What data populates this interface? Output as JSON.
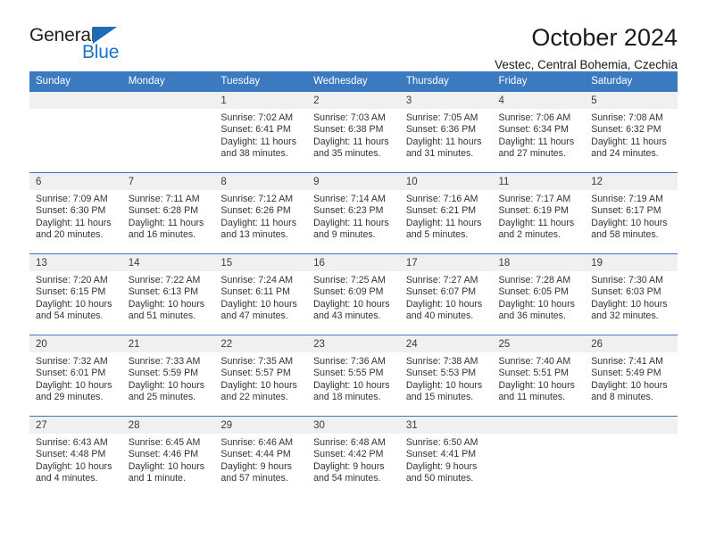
{
  "brand": {
    "name_top": "General",
    "name_bottom": "Blue",
    "triangle_icon": "brand-triangle-icon",
    "color_dark": "#231f20",
    "color_blue": "#1b74c7"
  },
  "header": {
    "title": "October 2024",
    "subtitle": "Vestec, Central Bohemia, Czechia"
  },
  "theme": {
    "header_blue": "#3b79c0",
    "daynum_band": "#f0f0f0",
    "text": "#333333"
  },
  "calendar": {
    "weekday_headers": [
      "Sunday",
      "Monday",
      "Tuesday",
      "Wednesday",
      "Thursday",
      "Friday",
      "Saturday"
    ],
    "labels": {
      "sunrise": "Sunrise:",
      "sunset": "Sunset:",
      "daylight": "Daylight:"
    },
    "weeks": [
      [
        {
          "day": "",
          "empty": true
        },
        {
          "day": "",
          "empty": true
        },
        {
          "day": "1",
          "sunrise": "Sunrise: 7:02 AM",
          "sunset": "Sunset: 6:41 PM",
          "daylight_1": "Daylight: 11 hours",
          "daylight_2": "and 38 minutes."
        },
        {
          "day": "2",
          "sunrise": "Sunrise: 7:03 AM",
          "sunset": "Sunset: 6:38 PM",
          "daylight_1": "Daylight: 11 hours",
          "daylight_2": "and 35 minutes."
        },
        {
          "day": "3",
          "sunrise": "Sunrise: 7:05 AM",
          "sunset": "Sunset: 6:36 PM",
          "daylight_1": "Daylight: 11 hours",
          "daylight_2": "and 31 minutes."
        },
        {
          "day": "4",
          "sunrise": "Sunrise: 7:06 AM",
          "sunset": "Sunset: 6:34 PM",
          "daylight_1": "Daylight: 11 hours",
          "daylight_2": "and 27 minutes."
        },
        {
          "day": "5",
          "sunrise": "Sunrise: 7:08 AM",
          "sunset": "Sunset: 6:32 PM",
          "daylight_1": "Daylight: 11 hours",
          "daylight_2": "and 24 minutes."
        }
      ],
      [
        {
          "day": "6",
          "sunrise": "Sunrise: 7:09 AM",
          "sunset": "Sunset: 6:30 PM",
          "daylight_1": "Daylight: 11 hours",
          "daylight_2": "and 20 minutes."
        },
        {
          "day": "7",
          "sunrise": "Sunrise: 7:11 AM",
          "sunset": "Sunset: 6:28 PM",
          "daylight_1": "Daylight: 11 hours",
          "daylight_2": "and 16 minutes."
        },
        {
          "day": "8",
          "sunrise": "Sunrise: 7:12 AM",
          "sunset": "Sunset: 6:26 PM",
          "daylight_1": "Daylight: 11 hours",
          "daylight_2": "and 13 minutes."
        },
        {
          "day": "9",
          "sunrise": "Sunrise: 7:14 AM",
          "sunset": "Sunset: 6:23 PM",
          "daylight_1": "Daylight: 11 hours",
          "daylight_2": "and 9 minutes."
        },
        {
          "day": "10",
          "sunrise": "Sunrise: 7:16 AM",
          "sunset": "Sunset: 6:21 PM",
          "daylight_1": "Daylight: 11 hours",
          "daylight_2": "and 5 minutes."
        },
        {
          "day": "11",
          "sunrise": "Sunrise: 7:17 AM",
          "sunset": "Sunset: 6:19 PM",
          "daylight_1": "Daylight: 11 hours",
          "daylight_2": "and 2 minutes."
        },
        {
          "day": "12",
          "sunrise": "Sunrise: 7:19 AM",
          "sunset": "Sunset: 6:17 PM",
          "daylight_1": "Daylight: 10 hours",
          "daylight_2": "and 58 minutes."
        }
      ],
      [
        {
          "day": "13",
          "sunrise": "Sunrise: 7:20 AM",
          "sunset": "Sunset: 6:15 PM",
          "daylight_1": "Daylight: 10 hours",
          "daylight_2": "and 54 minutes."
        },
        {
          "day": "14",
          "sunrise": "Sunrise: 7:22 AM",
          "sunset": "Sunset: 6:13 PM",
          "daylight_1": "Daylight: 10 hours",
          "daylight_2": "and 51 minutes."
        },
        {
          "day": "15",
          "sunrise": "Sunrise: 7:24 AM",
          "sunset": "Sunset: 6:11 PM",
          "daylight_1": "Daylight: 10 hours",
          "daylight_2": "and 47 minutes."
        },
        {
          "day": "16",
          "sunrise": "Sunrise: 7:25 AM",
          "sunset": "Sunset: 6:09 PM",
          "daylight_1": "Daylight: 10 hours",
          "daylight_2": "and 43 minutes."
        },
        {
          "day": "17",
          "sunrise": "Sunrise: 7:27 AM",
          "sunset": "Sunset: 6:07 PM",
          "daylight_1": "Daylight: 10 hours",
          "daylight_2": "and 40 minutes."
        },
        {
          "day": "18",
          "sunrise": "Sunrise: 7:28 AM",
          "sunset": "Sunset: 6:05 PM",
          "daylight_1": "Daylight: 10 hours",
          "daylight_2": "and 36 minutes."
        },
        {
          "day": "19",
          "sunrise": "Sunrise: 7:30 AM",
          "sunset": "Sunset: 6:03 PM",
          "daylight_1": "Daylight: 10 hours",
          "daylight_2": "and 32 minutes."
        }
      ],
      [
        {
          "day": "20",
          "sunrise": "Sunrise: 7:32 AM",
          "sunset": "Sunset: 6:01 PM",
          "daylight_1": "Daylight: 10 hours",
          "daylight_2": "and 29 minutes."
        },
        {
          "day": "21",
          "sunrise": "Sunrise: 7:33 AM",
          "sunset": "Sunset: 5:59 PM",
          "daylight_1": "Daylight: 10 hours",
          "daylight_2": "and 25 minutes."
        },
        {
          "day": "22",
          "sunrise": "Sunrise: 7:35 AM",
          "sunset": "Sunset: 5:57 PM",
          "daylight_1": "Daylight: 10 hours",
          "daylight_2": "and 22 minutes."
        },
        {
          "day": "23",
          "sunrise": "Sunrise: 7:36 AM",
          "sunset": "Sunset: 5:55 PM",
          "daylight_1": "Daylight: 10 hours",
          "daylight_2": "and 18 minutes."
        },
        {
          "day": "24",
          "sunrise": "Sunrise: 7:38 AM",
          "sunset": "Sunset: 5:53 PM",
          "daylight_1": "Daylight: 10 hours",
          "daylight_2": "and 15 minutes."
        },
        {
          "day": "25",
          "sunrise": "Sunrise: 7:40 AM",
          "sunset": "Sunset: 5:51 PM",
          "daylight_1": "Daylight: 10 hours",
          "daylight_2": "and 11 minutes."
        },
        {
          "day": "26",
          "sunrise": "Sunrise: 7:41 AM",
          "sunset": "Sunset: 5:49 PM",
          "daylight_1": "Daylight: 10 hours",
          "daylight_2": "and 8 minutes."
        }
      ],
      [
        {
          "day": "27",
          "sunrise": "Sunrise: 6:43 AM",
          "sunset": "Sunset: 4:48 PM",
          "daylight_1": "Daylight: 10 hours",
          "daylight_2": "and 4 minutes."
        },
        {
          "day": "28",
          "sunrise": "Sunrise: 6:45 AM",
          "sunset": "Sunset: 4:46 PM",
          "daylight_1": "Daylight: 10 hours",
          "daylight_2": "and 1 minute."
        },
        {
          "day": "29",
          "sunrise": "Sunrise: 6:46 AM",
          "sunset": "Sunset: 4:44 PM",
          "daylight_1": "Daylight: 9 hours",
          "daylight_2": "and 57 minutes."
        },
        {
          "day": "30",
          "sunrise": "Sunrise: 6:48 AM",
          "sunset": "Sunset: 4:42 PM",
          "daylight_1": "Daylight: 9 hours",
          "daylight_2": "and 54 minutes."
        },
        {
          "day": "31",
          "sunrise": "Sunrise: 6:50 AM",
          "sunset": "Sunset: 4:41 PM",
          "daylight_1": "Daylight: 9 hours",
          "daylight_2": "and 50 minutes."
        },
        {
          "day": "",
          "empty": true
        },
        {
          "day": "",
          "empty": true
        }
      ]
    ]
  }
}
